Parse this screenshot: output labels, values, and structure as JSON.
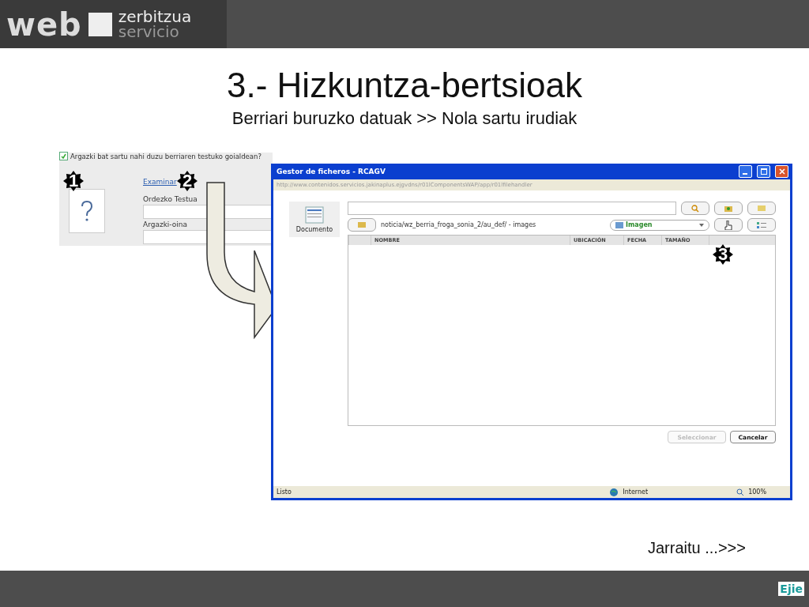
{
  "header": {
    "logo_main": "web",
    "logo_line1": "zerbitzua",
    "logo_line2": "servicio"
  },
  "title": "3.- Hizkuntza-bertsioak",
  "subtitle": "Berriari buruzko datuak >> Nola sartu irudiak",
  "form": {
    "checkbox": {
      "label": "Argazki bat sartu nahi duzu berriaren testuko goialdean?",
      "checked": true
    },
    "link": "Examinar",
    "fields": [
      {
        "label": "Ordezko Testua"
      },
      {
        "label": "Argazki-oina"
      }
    ]
  },
  "steps": [
    "1",
    "2",
    "3"
  ],
  "window": {
    "title": "Gestor de ficheros - RCAGV",
    "url": "http://www.contenidos.servicios.jakinaplus.ejgvdns/r01lComponentsWAP/app/r01lfilehandler",
    "sidebar_item": "Documento",
    "path": "noticia/wz_berria_froga_sonia_2/au_def/ - images",
    "type_select": "Imagen",
    "columns": [
      "NOMBRE",
      "UBICACIÓN",
      "FECHA",
      "TAMAÑO"
    ],
    "buttons": [
      {
        "label": "Seleccionar",
        "disabled": true
      },
      {
        "label": "Cancelar",
        "disabled": false
      }
    ],
    "status_bar": {
      "status": "Listo",
      "zone": "Internet",
      "zoom": "100%"
    }
  },
  "next_link": "Jarraitu ...>>>",
  "footer_logo": "Ejie"
}
